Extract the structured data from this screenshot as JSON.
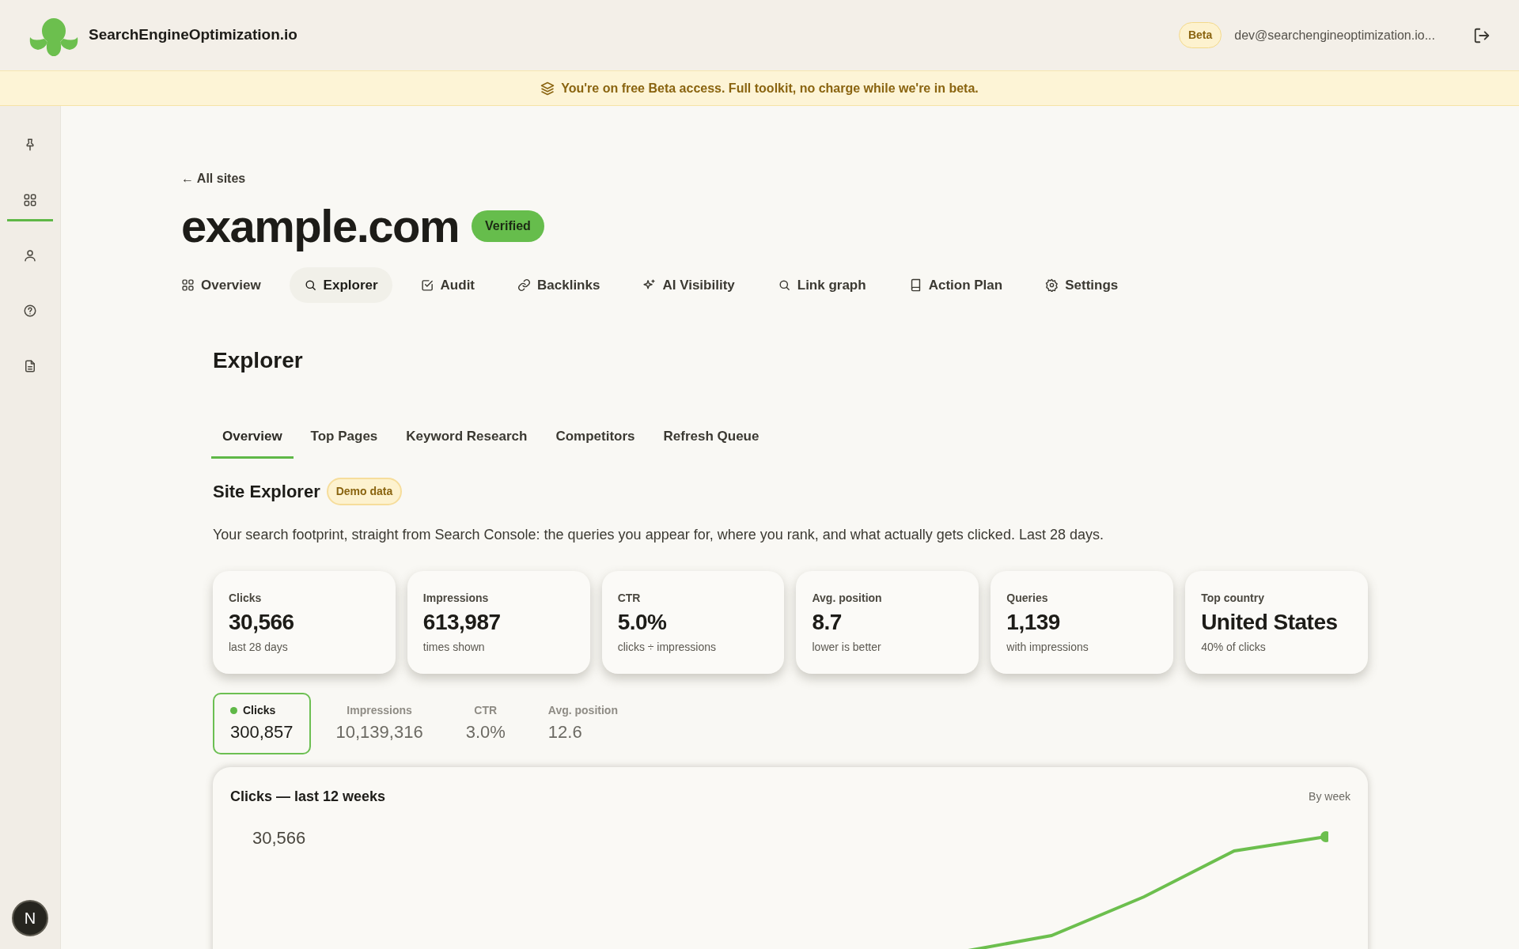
{
  "header": {
    "brand": "SearchEngineOptimization.io",
    "badge": "Beta",
    "email": "dev@searchengineoptimization.io..."
  },
  "banner": {
    "text": "You're on free Beta access. Full toolkit, no charge while we're in beta."
  },
  "sidebar": {
    "items": [
      {
        "kind": "pin",
        "selected": false
      },
      {
        "kind": "grid",
        "selected": true
      },
      {
        "kind": "user",
        "selected": false
      },
      {
        "kind": "help",
        "selected": false
      },
      {
        "kind": "document",
        "selected": false
      }
    ],
    "avatar": "N"
  },
  "back_link": "← All sites",
  "site": {
    "title": "example.com",
    "status": "Verified"
  },
  "nav_tabs": [
    {
      "label": "Overview",
      "kind": "grid",
      "selected": false
    },
    {
      "label": "Explorer",
      "kind": "search",
      "selected": true
    },
    {
      "label": "Audit",
      "kind": "check",
      "selected": false
    },
    {
      "label": "Backlinks",
      "kind": "link",
      "selected": false
    },
    {
      "label": "AI Visibility",
      "kind": "sparkle",
      "selected": false
    },
    {
      "label": "Link graph",
      "kind": "search",
      "selected": false
    },
    {
      "label": "Action Plan",
      "kind": "book",
      "selected": false
    },
    {
      "label": "Settings",
      "kind": "gear",
      "selected": false
    }
  ],
  "section_title": "Explorer",
  "sub_tabs": [
    {
      "label": "Overview",
      "selected": true
    },
    {
      "label": "Top Pages",
      "selected": false
    },
    {
      "label": "Keyword Research",
      "selected": false
    },
    {
      "label": "Competitors",
      "selected": false
    },
    {
      "label": "Refresh Queue",
      "selected": false
    }
  ],
  "site_explorer": {
    "title": "Site Explorer",
    "badge": "Demo data",
    "description": "Your search footprint, straight from Search Console: the queries you appear for, where you rank, and what actually gets clicked. Last 28 days."
  },
  "stat_cards": [
    {
      "label": "Clicks",
      "value": "30,566",
      "note": "last 28 days"
    },
    {
      "label": "Impressions",
      "value": "613,987",
      "note": "times shown"
    },
    {
      "label": "CTR",
      "value": "5.0%",
      "note": "clicks ÷ impressions"
    },
    {
      "label": "Avg. position",
      "value": "8.7",
      "note": "lower is better"
    },
    {
      "label": "Queries",
      "value": "1,139",
      "note": "with impressions"
    },
    {
      "label": "Top country",
      "value": "United States",
      "note": "40% of clicks"
    }
  ],
  "metric_tabs": [
    {
      "label": "Clicks",
      "value": "300,857",
      "selected": true
    },
    {
      "label": "Impressions",
      "value": "10,139,316",
      "selected": false
    },
    {
      "label": "CTR",
      "value": "3.0%",
      "selected": false
    },
    {
      "label": "Avg. position",
      "value": "12.6",
      "selected": false
    }
  ],
  "chart": {
    "title": "Clicks — last 12 weeks",
    "period": "By week",
    "latest": "30,566"
  }
}
